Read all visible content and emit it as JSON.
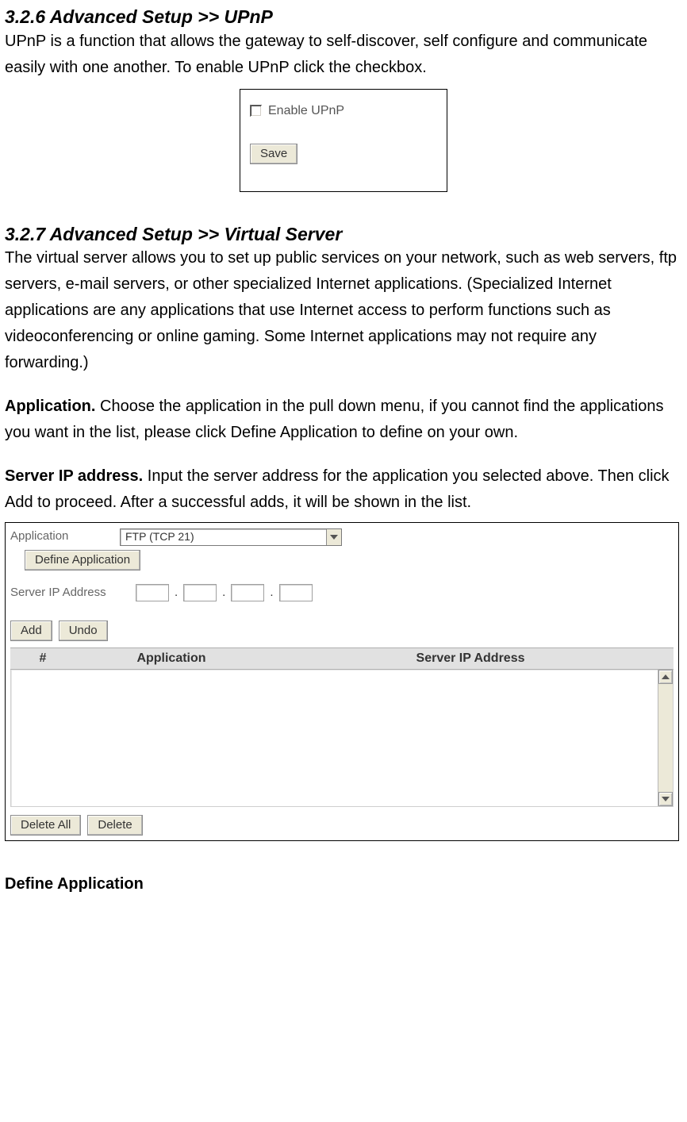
{
  "section_upnp": {
    "heading": "3.2.6 Advanced Setup >> UPnP",
    "description": "UPnP is a function that allows the gateway to self-discover, self configure and communicate easily with one another. To enable UPnP click the checkbox.",
    "figure": {
      "checkbox_label": "Enable UPnP",
      "save_button": "Save"
    }
  },
  "section_vs": {
    "heading": "3.2.7 Advanced Setup >> Virtual Server",
    "description": "The virtual server allows you to set up public services on your network, such as web servers, ftp servers, e-mail servers, or other specialized Internet applications. (Specialized Internet applications are any applications that use Internet access to perform functions such as videoconferencing or online gaming. Some Internet applications may not require any forwarding.)",
    "application_label": "Application.",
    "application_text": " Choose the application in the pull down menu, if you cannot find the applications you want in the list, please click Define Application to define on your own.",
    "serverip_label": "Server IP address.",
    "serverip_text": " Input the server address for the application you selected above. Then click Add to proceed. After a successful adds, it will be shown in the list.",
    "figure": {
      "application_field_label": "Application",
      "application_selected": "FTP (TCP 21)",
      "define_button": "Define Application",
      "server_ip_label": "Server IP Address",
      "add_button": "Add",
      "undo_button": "Undo",
      "table": {
        "col_num": "#",
        "col_app": "Application",
        "col_ip": "Server IP Address"
      },
      "delete_all_button": "Delete All",
      "delete_button": "Delete"
    }
  },
  "define_app_heading": "Define Application"
}
